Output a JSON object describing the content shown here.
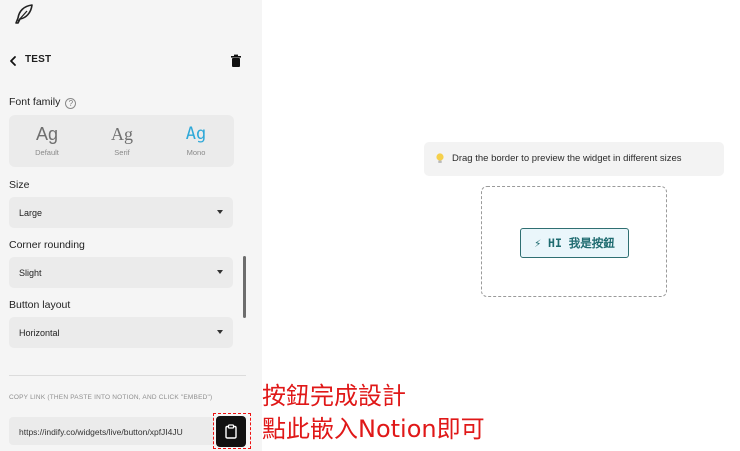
{
  "sidebar": {
    "title": "TEST",
    "font_family": {
      "label": "Font family",
      "help": "?",
      "options": [
        {
          "sample": "Ag",
          "caption": "Default"
        },
        {
          "sample": "Ag",
          "caption": "Serif"
        },
        {
          "sample": "Ag",
          "caption": "Mono"
        }
      ],
      "selected": "Mono",
      "selected_color": "#2ea8d8"
    },
    "size": {
      "label": "Size",
      "value": "Large"
    },
    "corner_rounding": {
      "label": "Corner rounding",
      "value": "Slight"
    },
    "button_layout": {
      "label": "Button layout",
      "value": "Horizontal"
    },
    "copy_link": {
      "label": "COPY LINK (THEN PASTE INTO NOTION, AND CLICK \"EMBED\")",
      "value": "https://indify.co/widgets/live/button/xpfJI4JU"
    }
  },
  "annotations": {
    "line1": "按鈕完成設計",
    "line2": "點此嵌入Notion即可",
    "color": "#e01818"
  },
  "preview": {
    "hint": "Drag the border to preview the widget in different sizes",
    "button_label": "⚡ HI 我是按鈕"
  }
}
